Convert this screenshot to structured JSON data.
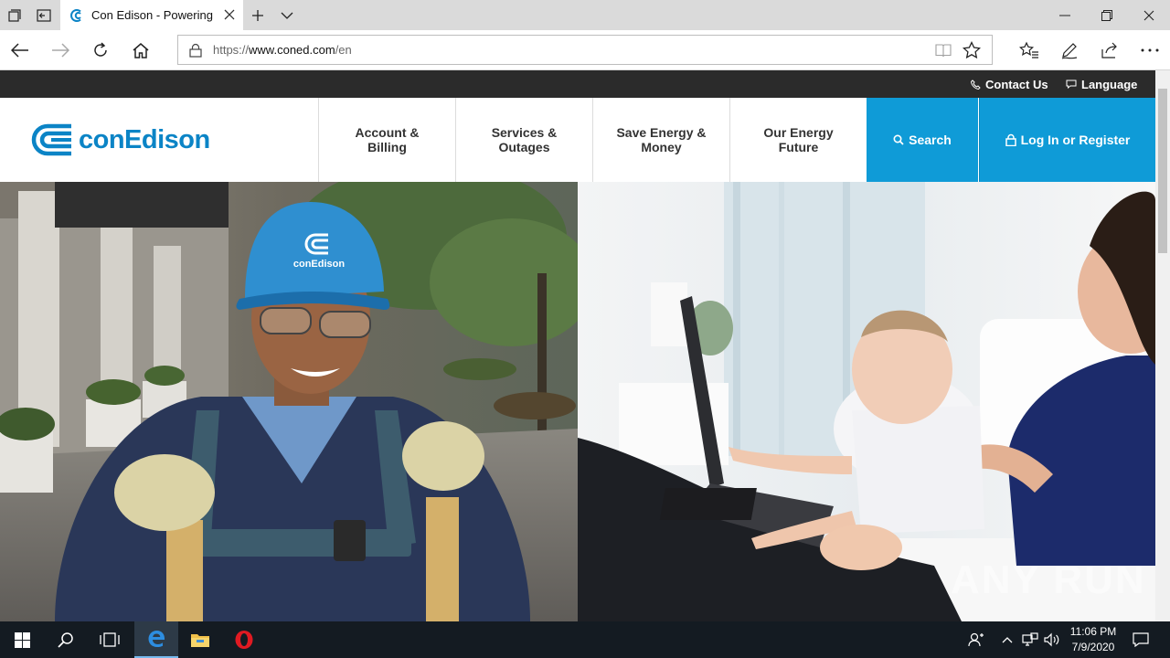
{
  "browser": {
    "tab_title": "Con Edison - Powering N",
    "url_prefix": "https://",
    "url_domain": "www.coned.com",
    "url_path": "/en"
  },
  "site": {
    "utility_links": {
      "contact": "Contact Us",
      "language": "Language"
    },
    "logo_text": "conEdison",
    "menu": [
      {
        "line1": "Account &",
        "line2": "Billing"
      },
      {
        "line1": "Services &",
        "line2": "Outages"
      },
      {
        "line1": "Save Energy &",
        "line2": "Money"
      },
      {
        "line1": "Our Energy",
        "line2": "Future"
      }
    ],
    "search_label": "Search",
    "login_label": "Log In or Register",
    "hardhat_text": "conEdison",
    "brand_color": "#0f9bd7"
  },
  "watermark": "ANY RUN",
  "taskbar": {
    "time": "11:06 PM",
    "date": "7/9/2020"
  }
}
